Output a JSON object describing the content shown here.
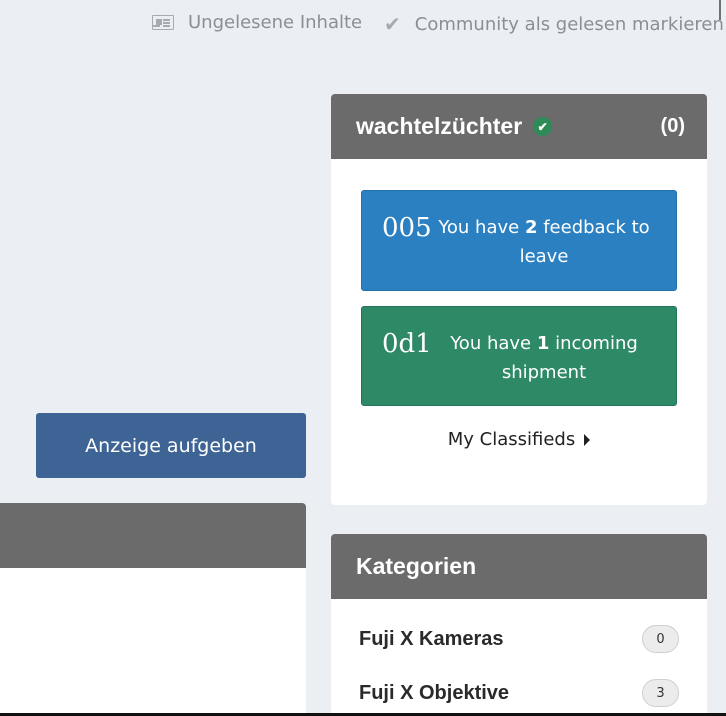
{
  "topbar": {
    "unread_label": "Ungelesene Inhalte",
    "mark_read_label": "Community als gelesen markieren"
  },
  "user_widget": {
    "username": "wachtelzüchter",
    "count": "(0)",
    "feedback": {
      "code": "005",
      "pre": "You have ",
      "num": "2",
      "post": " feedback to leave"
    },
    "shipment": {
      "code": "0d1",
      "pre": "You have ",
      "num": "1",
      "post": " incoming shipment"
    },
    "classifieds_link": "My Classifieds"
  },
  "post_ad_button": "Anzeige aufgeben",
  "categories": {
    "title": "Kategorien",
    "items": [
      {
        "name": "Fuji X Kameras",
        "count": "0"
      },
      {
        "name": "Fuji X Objektive",
        "count": "3"
      }
    ]
  },
  "colors": {
    "header_bg": "#6b6b6b",
    "feedback_bg": "#2b80c2",
    "shipment_bg": "#2e8a66",
    "button_bg": "#3d6494",
    "verified": "#2e8b57"
  }
}
